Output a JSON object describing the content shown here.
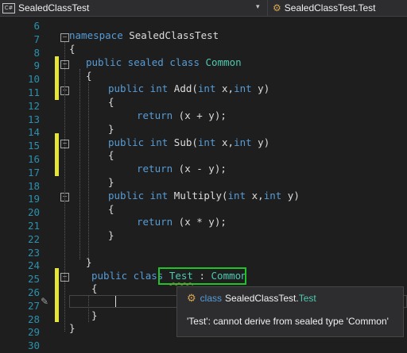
{
  "topbar": {
    "project_icon_text": "C#",
    "project_name": "SealedClassTest",
    "dropdown_arrow": "▾",
    "class_selector": "SealedClassTest.Test"
  },
  "line_numbers": [
    "6",
    "7",
    "8",
    "9",
    "10",
    "11",
    "12",
    "13",
    "14",
    "15",
    "16",
    "17",
    "18",
    "19",
    "20",
    "21",
    "22",
    "23",
    "24",
    "25",
    "26",
    "27",
    "28",
    "29",
    "30"
  ],
  "code": {
    "l7_kw": "namespace",
    "l7_name": " SealedClassTest",
    "l8": "{",
    "l9_kw": "public sealed class",
    "l9_type": "Common",
    "l10": "{",
    "l11_kw1": "public int",
    "l11_rest1": " Add(",
    "l11_kw2": "int",
    "l11_rest2": " x,",
    "l11_kw3": "int",
    "l11_rest3": " y)",
    "l12": "{",
    "l13_kw": "return",
    "l13_rest": " (x + y);",
    "l14": "}",
    "l15_kw1": "public int",
    "l15_rest1": " Sub(",
    "l15_kw2": "int",
    "l15_rest2": " x,",
    "l15_kw3": "int",
    "l15_rest3": " y)",
    "l16": "{",
    "l17_kw": "return",
    "l17_rest": " (x - y);",
    "l18": "}",
    "l19_kw1": "public int",
    "l19_rest1": " Multiply(",
    "l19_kw2": "int",
    "l19_rest2": " x,",
    "l19_kw3": "int",
    "l19_rest3": " y)",
    "l20": "{",
    "l21_kw": "return",
    "l21_rest": " (x * y);",
    "l22": "}",
    "l24": "}",
    "l25_kw": "public class",
    "l25_type": "Test",
    "l25_colon": " : ",
    "l25_base": "Common",
    "l26": "{",
    "l28": "}",
    "l29": "}"
  },
  "tooltip": {
    "kind": "class",
    "namespace": "SealedClassTest.",
    "type_name": "Test",
    "error": "'Test': cannot derive from sealed type 'Common'"
  },
  "colors": {
    "background": "#1e1e1e",
    "keyword": "#569cd6",
    "type": "#4ec9b0",
    "line_number": "#2b91af",
    "change_bar": "#e5e43a",
    "highlight_box": "#22c22b",
    "error_squiggle": "#e05252"
  },
  "icons": {
    "project": "csharp-project-icon",
    "class": "class-icon",
    "fold": "fold-minus-icon",
    "quick_action": "pencil-icon"
  },
  "fold_glyph": "−",
  "class_glyph": "⚙",
  "pencil_glyph": "✎"
}
